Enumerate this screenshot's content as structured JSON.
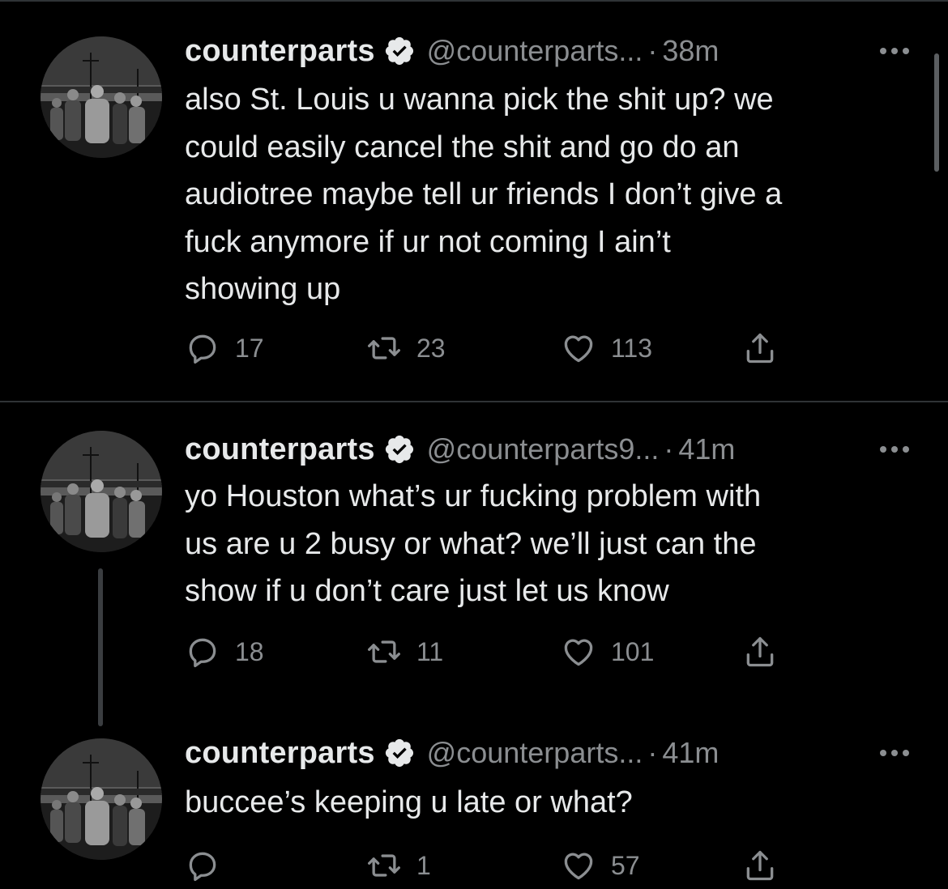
{
  "tweets": [
    {
      "name": "counterparts",
      "handle": "@counterparts...",
      "time": "38m",
      "text": "also St. Louis u wanna pick the shit up? we\ncould easily cancel the shit and go do an\naudiotree maybe tell ur friends I don’t give a\nfuck anymore if ur not coming I ain’t\nshowing up",
      "replies": "17",
      "retweets": "23",
      "likes": "113"
    },
    {
      "name": "counterparts",
      "handle": "@counterparts9...",
      "time": "41m",
      "text": "yo Houston what’s ur fucking problem with\nus are u 2 busy or what? we’ll just can the\nshow if u don’t care just let us know",
      "replies": "18",
      "retweets": "11",
      "likes": "101"
    },
    {
      "name": "counterparts",
      "handle": "@counterparts...",
      "time": "41m",
      "text": "buccee’s keeping u late or what?",
      "replies": "",
      "retweets": "1",
      "likes": "57"
    }
  ],
  "ui": {
    "separator_dot": "·",
    "colors": {
      "background": "#000000",
      "text": "#e7e9ea",
      "muted": "#8b8e91",
      "divider": "#2f3336"
    },
    "icons": [
      "verified-badge-icon",
      "more-icon",
      "reply-icon",
      "retweet-icon",
      "like-icon",
      "share-icon"
    ]
  }
}
